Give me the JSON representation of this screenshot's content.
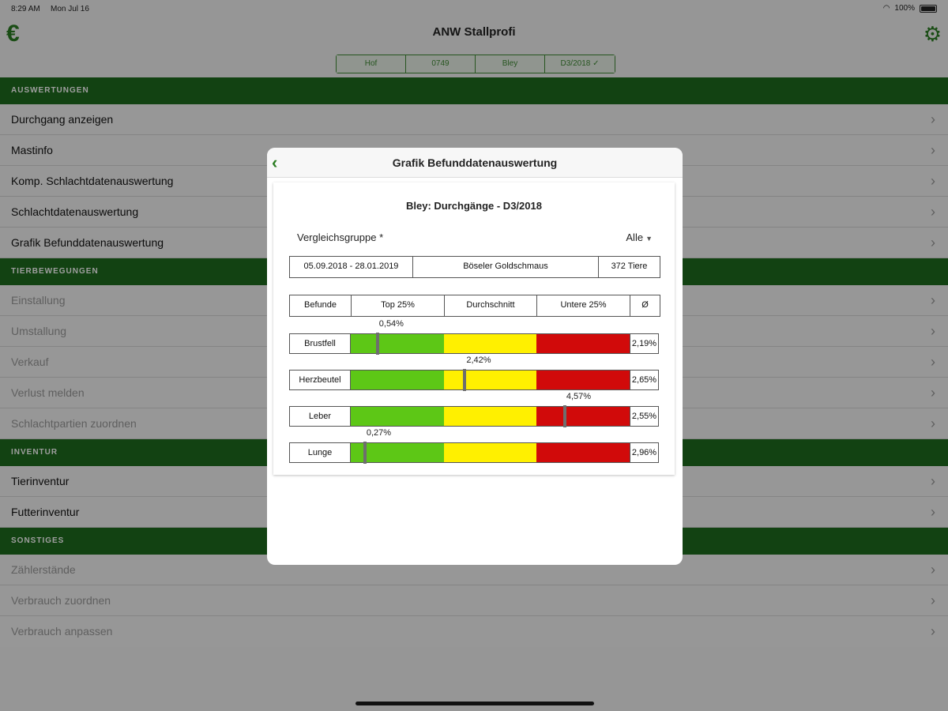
{
  "status_bar": {
    "time": "8:29 AM",
    "date": "Mon Jul 16",
    "battery": "100%"
  },
  "header": {
    "title": "ANW Stallprofi",
    "euro_icon": "€",
    "settings_icon": "gear-icon",
    "segments": [
      "Hof",
      "0749",
      "Bley",
      "D3/2018 ✓"
    ]
  },
  "sections": [
    {
      "title": "AUSWERTUNGEN",
      "items": [
        {
          "label": "Durchgang anzeigen",
          "enabled": true
        },
        {
          "label": "Mastinfo",
          "enabled": true
        },
        {
          "label": "Komp. Schlachtdatenauswertung",
          "enabled": true
        },
        {
          "label": "Schlachtdatenauswertung",
          "enabled": true
        },
        {
          "label": "Grafik Befunddatenauswertung",
          "enabled": true
        }
      ]
    },
    {
      "title": "TIERBEWEGUNGEN",
      "items": [
        {
          "label": "Einstallung",
          "enabled": false
        },
        {
          "label": "Umstallung",
          "enabled": false
        },
        {
          "label": "Verkauf",
          "enabled": false
        },
        {
          "label": "Verlust melden",
          "enabled": false
        },
        {
          "label": "Schlachtpartien zuordnen",
          "enabled": false
        }
      ]
    },
    {
      "title": "INVENTUR",
      "items": [
        {
          "label": "Tierinventur",
          "enabled": true
        },
        {
          "label": "Futterinventur",
          "enabled": true
        }
      ]
    },
    {
      "title": "SONSTIGES",
      "items": [
        {
          "label": "Zählerstände",
          "enabled": false
        },
        {
          "label": "Verbrauch zuordnen",
          "enabled": false
        },
        {
          "label": "Verbrauch anpassen",
          "enabled": false
        }
      ]
    }
  ],
  "modal": {
    "title": "Grafik Befunddatenauswertung",
    "card_title": "Bley: Durchgänge - D3/2018",
    "vergleichsgruppe_label": "Vergleichsgruppe *",
    "vergleichsgruppe_value": "Alle",
    "info": {
      "period": "05.09.2018 - 28.01.2019",
      "group": "Böseler Goldschmaus",
      "animals": "372 Tiere"
    },
    "columns": [
      "Befunde",
      "Top 25%",
      "Durchschnitt",
      "Untere 25%",
      "Ø"
    ],
    "rows": [
      {
        "label": "Brustfell",
        "value": 0.54,
        "value_label": "0,54%",
        "avg": "2,19%"
      },
      {
        "label": "Herzbeutel",
        "value": 2.42,
        "value_label": "2,42%",
        "avg": "2,65%"
      },
      {
        "label": "Leber",
        "value": 4.57,
        "value_label": "4,57%",
        "avg": "2,55%"
      },
      {
        "label": "Lunge",
        "value": 0.27,
        "value_label": "0,27%",
        "avg": "2,96%"
      }
    ],
    "colors": {
      "top": "#5dc716",
      "mid": "#fff000",
      "bottom": "#d10a0a"
    }
  }
}
